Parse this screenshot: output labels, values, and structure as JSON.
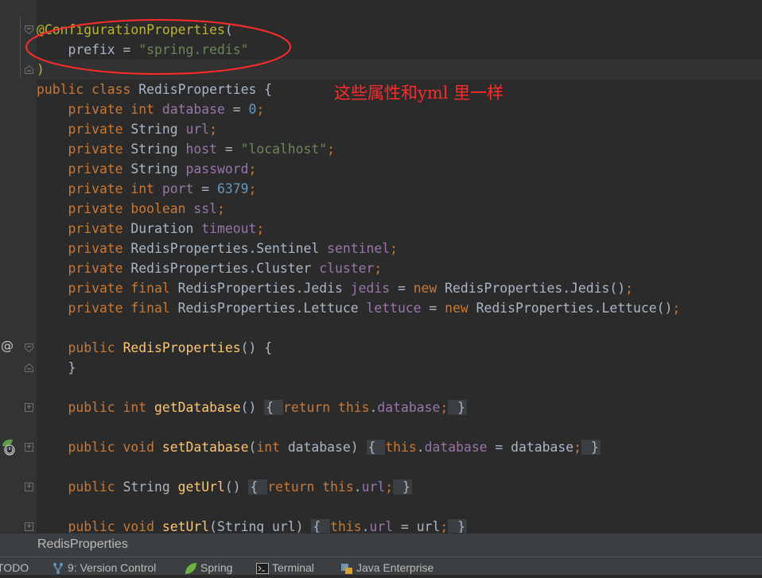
{
  "editor": {
    "lines": [
      {
        "id": "annotation",
        "segs": [
          [
            "ann",
            "@ConfigurationProperties"
          ],
          [
            "plain",
            "("
          ]
        ]
      },
      {
        "id": "prefix",
        "segs": [
          [
            "plain",
            "    prefix = "
          ],
          [
            "str",
            "\"spring.redis\""
          ]
        ]
      },
      {
        "id": "annotation-close",
        "segs": [
          [
            "ann",
            ")"
          ]
        ]
      },
      {
        "id": "class-decl",
        "segs": [
          [
            "kw",
            "public class "
          ],
          [
            "plain",
            "RedisProperties {"
          ]
        ]
      },
      {
        "id": "field-database",
        "segs": [
          [
            "kw",
            "    private int "
          ],
          [
            "fld",
            "database"
          ],
          [
            "plain",
            " = "
          ],
          [
            "num",
            "0"
          ],
          [
            "kw",
            ";"
          ]
        ]
      },
      {
        "id": "field-url",
        "segs": [
          [
            "kw",
            "    private "
          ],
          [
            "plain",
            "String "
          ],
          [
            "fld",
            "url"
          ],
          [
            "kw",
            ";"
          ]
        ]
      },
      {
        "id": "field-host",
        "segs": [
          [
            "kw",
            "    private "
          ],
          [
            "plain",
            "String "
          ],
          [
            "fld",
            "host"
          ],
          [
            "plain",
            " = "
          ],
          [
            "str",
            "\"localhost\""
          ],
          [
            "kw",
            ";"
          ]
        ]
      },
      {
        "id": "field-password",
        "segs": [
          [
            "kw",
            "    private "
          ],
          [
            "plain",
            "String "
          ],
          [
            "fld",
            "password"
          ],
          [
            "kw",
            ";"
          ]
        ]
      },
      {
        "id": "field-port",
        "segs": [
          [
            "kw",
            "    private int "
          ],
          [
            "fld",
            "port"
          ],
          [
            "plain",
            " = "
          ],
          [
            "num",
            "6379"
          ],
          [
            "kw",
            ";"
          ]
        ]
      },
      {
        "id": "field-ssl",
        "segs": [
          [
            "kw",
            "    private boolean "
          ],
          [
            "fld",
            "ssl"
          ],
          [
            "kw",
            ";"
          ]
        ]
      },
      {
        "id": "field-timeout",
        "segs": [
          [
            "kw",
            "    private "
          ],
          [
            "plain",
            "Duration "
          ],
          [
            "fld",
            "timeout"
          ],
          [
            "kw",
            ";"
          ]
        ]
      },
      {
        "id": "field-sentinel",
        "segs": [
          [
            "kw",
            "    private "
          ],
          [
            "plain",
            "RedisProperties.Sentinel "
          ],
          [
            "fld",
            "sentinel"
          ],
          [
            "kw",
            ";"
          ]
        ]
      },
      {
        "id": "field-cluster",
        "segs": [
          [
            "kw",
            "    private "
          ],
          [
            "plain",
            "RedisProperties.Cluster "
          ],
          [
            "fld",
            "cluster"
          ],
          [
            "kw",
            ";"
          ]
        ]
      },
      {
        "id": "field-jedis",
        "segs": [
          [
            "kw",
            "    private final "
          ],
          [
            "plain",
            "RedisProperties.Jedis "
          ],
          [
            "fld",
            "jedis"
          ],
          [
            "plain",
            " = "
          ],
          [
            "kw",
            "new "
          ],
          [
            "plain",
            "RedisProperties.Jedis()"
          ],
          [
            "kw",
            ";"
          ]
        ]
      },
      {
        "id": "field-lettuce",
        "segs": [
          [
            "kw",
            "    private final "
          ],
          [
            "plain",
            "RedisProperties.Lettuce "
          ],
          [
            "fld",
            "lettuce"
          ],
          [
            "plain",
            " = "
          ],
          [
            "kw",
            "new "
          ],
          [
            "plain",
            "RedisProperties.Lettuce()"
          ],
          [
            "kw",
            ";"
          ]
        ]
      },
      {
        "id": "blank-1",
        "segs": []
      },
      {
        "id": "constructor",
        "segs": [
          [
            "kw",
            "    public "
          ],
          [
            "fn",
            "RedisProperties"
          ],
          [
            "plain",
            "() {"
          ]
        ]
      },
      {
        "id": "constructor-close",
        "segs": [
          [
            "plain",
            "    }"
          ]
        ]
      },
      {
        "id": "blank-2",
        "segs": []
      },
      {
        "id": "get-database",
        "segs": [
          [
            "kw",
            "    public int "
          ],
          [
            "fn",
            "getDatabase"
          ],
          [
            "plain",
            "() "
          ],
          [
            "brace",
            "{ "
          ],
          [
            "kw",
            "return this"
          ],
          [
            "plain",
            "."
          ],
          [
            "fld",
            "database"
          ],
          [
            "kw",
            ";"
          ],
          [
            "brace",
            " }"
          ]
        ]
      },
      {
        "id": "blank-3",
        "segs": []
      },
      {
        "id": "set-database",
        "segs": [
          [
            "kw",
            "    public void "
          ],
          [
            "fn",
            "setDatabase"
          ],
          [
            "plain",
            "("
          ],
          [
            "kw",
            "int "
          ],
          [
            "plain",
            "database) "
          ],
          [
            "brace",
            "{ "
          ],
          [
            "kw",
            "this"
          ],
          [
            "plain",
            "."
          ],
          [
            "fld",
            "database"
          ],
          [
            "plain",
            " = database"
          ],
          [
            "kw",
            ";"
          ],
          [
            "brace",
            " }"
          ]
        ]
      },
      {
        "id": "blank-4",
        "segs": []
      },
      {
        "id": "get-url",
        "segs": [
          [
            "kw",
            "    public "
          ],
          [
            "plain",
            "String "
          ],
          [
            "fn",
            "getUrl"
          ],
          [
            "plain",
            "() "
          ],
          [
            "brace",
            "{ "
          ],
          [
            "kw",
            "return this"
          ],
          [
            "plain",
            "."
          ],
          [
            "fld",
            "url"
          ],
          [
            "kw",
            ";"
          ],
          [
            "brace",
            " }"
          ]
        ]
      },
      {
        "id": "blank-5",
        "segs": []
      },
      {
        "id": "set-url",
        "segs": [
          [
            "kw",
            "    public void "
          ],
          [
            "fn",
            "setUrl"
          ],
          [
            "plain",
            "(String url) "
          ],
          [
            "brace",
            "{ "
          ],
          [
            "kw",
            "this"
          ],
          [
            "plain",
            "."
          ],
          [
            "fld",
            "url"
          ],
          [
            "plain",
            " = url"
          ],
          [
            "kw",
            ";"
          ],
          [
            "brace",
            " }"
          ]
        ]
      }
    ],
    "handwritten_note": "这些属性和yml 里一样"
  },
  "gutter": {
    "at_icon": "@",
    "fold_icons": [
      "fold-start-icon",
      "fold-end-icon",
      "fold-start-icon",
      "fold-end-icon",
      "expand-icon",
      "expand-icon",
      "expand-icon",
      "expand-icon"
    ]
  },
  "breadcrumb": {
    "label": "RedisProperties"
  },
  "status_bar": {
    "tabs": [
      {
        "id": "todo",
        "label": "TODO",
        "icon": ""
      },
      {
        "id": "version-control",
        "label": "9: Version Control",
        "icon": "vcs-icon"
      },
      {
        "id": "spring",
        "label": "Spring",
        "icon": "spring-leaf-icon"
      },
      {
        "id": "terminal",
        "label": "Terminal",
        "icon": "terminal-icon"
      },
      {
        "id": "java-enterprise",
        "label": "Java Enterprise",
        "icon": "java-enterprise-icon"
      }
    ]
  },
  "colors": {
    "keyword": "#cc7832",
    "string": "#6a8759",
    "number": "#6897bb",
    "annotation": "#bbb529",
    "method": "#ffc66d",
    "field": "#9876aa",
    "text": "#a9b7c6",
    "highlight_ellipse": "#ff2b2b"
  }
}
